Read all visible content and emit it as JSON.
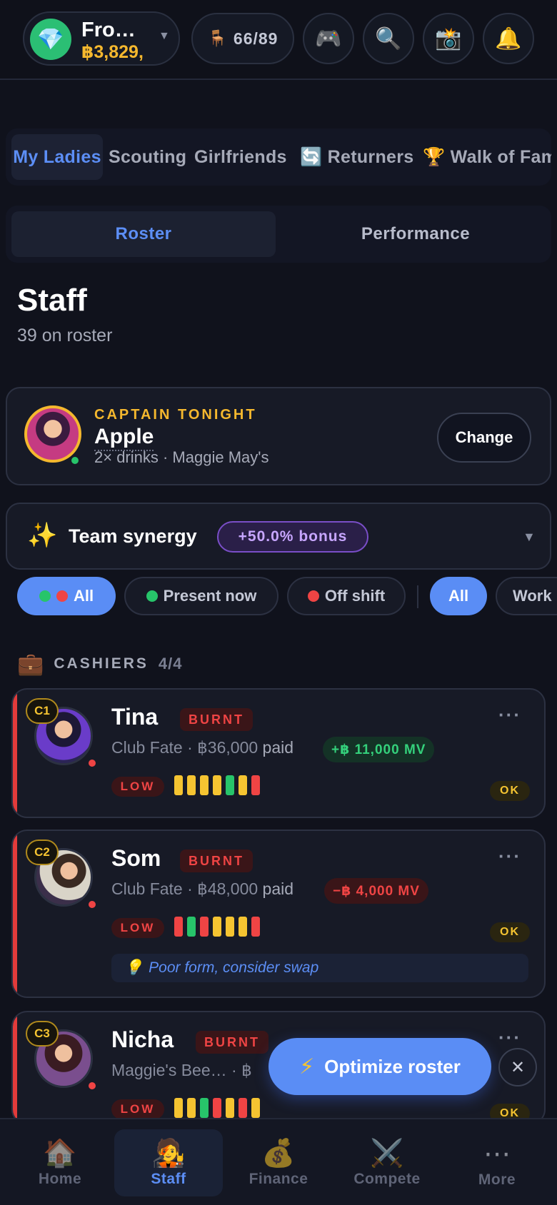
{
  "header": {
    "venue_name": "Fro…",
    "venue_cash": "฿3,829,",
    "venue_icon": "gem-icon",
    "seats": "66/89",
    "seats_icon": "chair-icon",
    "buttons": [
      "gamepad-icon",
      "search-icon",
      "camera-icon",
      "bell-icon"
    ]
  },
  "tabs": [
    "My Ladies",
    "Scouting",
    "Girlfriends",
    "🔄 Returners",
    "🏆 Walk of Fam"
  ],
  "segments": {
    "active": "Roster",
    "inactive": "Performance"
  },
  "page": {
    "title": "Staff",
    "subtitle": "39 on roster"
  },
  "captain": {
    "label": "CAPTAIN TONIGHT",
    "name": "Apple",
    "meta": "2× drinks · Maggie May's",
    "change_label": "Change"
  },
  "synergy": {
    "label": "Team synergy",
    "badge": "+50.0% bonus"
  },
  "filters": {
    "all": "All",
    "present": "Present now",
    "off_shift": "Off shift",
    "all2": "All",
    "work": "Work"
  },
  "section": {
    "label": "CASHIERS",
    "count": "4/4"
  },
  "staff": [
    {
      "rank": "C1",
      "name": "Tina",
      "status": "BURNT",
      "venue": "Club Fate",
      "paid": "฿36,000",
      "paid_suffix": "paid",
      "mv": "+฿ 11,000 MV",
      "mv_type": "pos",
      "form": "LOW",
      "form_bars": [
        "y",
        "y",
        "y",
        "y",
        "g",
        "y",
        "r"
      ],
      "health": "OK"
    },
    {
      "rank": "C2",
      "name": "Som",
      "status": "BURNT",
      "venue": "Club Fate",
      "paid": "฿48,000",
      "paid_suffix": "paid",
      "mv": "−฿ 4,000 MV",
      "mv_type": "neg",
      "form": "LOW",
      "form_bars": [
        "r",
        "g",
        "r",
        "y",
        "y",
        "y",
        "r"
      ],
      "health": "OK",
      "tip": "Poor form, consider swap"
    },
    {
      "rank": "C3",
      "name": "Nicha",
      "status": "BURNT",
      "venue": "Maggie's Bee…",
      "paid": "฿",
      "form": "LOW",
      "form_bars": [
        "y",
        "y",
        "g",
        "r",
        "y",
        "r",
        "y"
      ],
      "health": "OK"
    }
  ],
  "optimize_label": "Optimize roster",
  "nav": [
    {
      "label": "Home",
      "icon": "🏠"
    },
    {
      "label": "Staff",
      "icon": "🧑‍🎤"
    },
    {
      "label": "Finance",
      "icon": "💰"
    },
    {
      "label": "Compete",
      "icon": "⚔️"
    },
    {
      "label": "More",
      "icon": "⋯"
    }
  ]
}
